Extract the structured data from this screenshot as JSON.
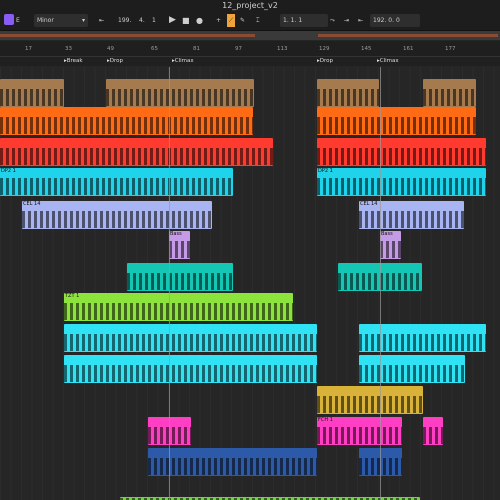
{
  "window": {
    "title": "12_project_v2"
  },
  "toolbar": {
    "key": "E",
    "scale": "Minor",
    "tempo": "199.",
    "tempo_fine": "4.",
    "signature": "1",
    "position": "1.",
    "position_beat": "1.",
    "position_tick": "1",
    "end_bar": "192.",
    "end_beat": "0.",
    "end_tick": "0"
  },
  "ruler": {
    "bars": [
      "17",
      "33",
      "49",
      "65",
      "81",
      "97",
      "113",
      "129",
      "145",
      "161",
      "177"
    ]
  },
  "markers": [
    "Break",
    "Drop",
    "Climax",
    "Drop",
    "Climax"
  ],
  "clip_labels": {
    "dp": "DP2 1",
    "cel": "CEL 14",
    "bass": "Bass",
    "tzt": "TZT 1",
    "fch": "FCH 1"
  },
  "colors": {
    "brown": "#a57a4e",
    "orange": "#ff6a14",
    "red": "#ff3b2f",
    "cyan": "#1ed3ea",
    "periwinkle": "#a9b4f2",
    "purple": "#c59be8",
    "teal": "#14c7b5",
    "lime": "#8ce33b",
    "sky": "#2fe3f5",
    "gold": "#d9b23a",
    "magenta": "#ff3fc3",
    "navy": "#2d5aa8",
    "green": "#6ed63b"
  }
}
